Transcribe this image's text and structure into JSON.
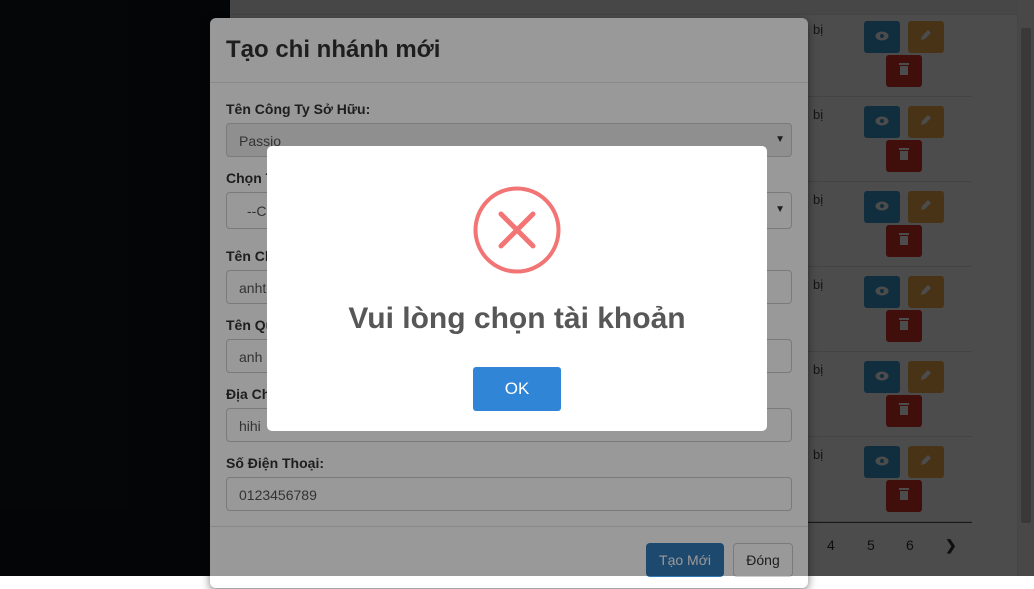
{
  "background_page": {
    "row_snippets": [
      "bị",
      "bị",
      "bị",
      "bị",
      "bị",
      "bị"
    ],
    "pagination": {
      "pages": [
        "4",
        "5",
        "6"
      ],
      "next_glyph": "❯"
    }
  },
  "create_branch_modal": {
    "title": "Tạo chi nhánh mới",
    "fields": [
      {
        "label": "Tên Công Ty Sở Hữu:",
        "value": "Passio",
        "type": "select"
      },
      {
        "label": "Chọn T",
        "value": "--Ch",
        "type": "select"
      },
      {
        "label": "Tên Ch",
        "value": "anhte",
        "type": "text"
      },
      {
        "label": "Tên Qu",
        "value": "anh",
        "type": "text"
      },
      {
        "label": "Địa Ch",
        "value": "hihi",
        "type": "text"
      },
      {
        "label": "Số Điện Thoại:",
        "value": "0123456789",
        "type": "text"
      }
    ],
    "submit_label": "Tạo Mới",
    "close_label": "Đóng"
  },
  "alert_dialog": {
    "icon": "error-x-icon",
    "message": "Vui lòng chọn tài khoản",
    "ok_label": "OK",
    "colors": {
      "icon": "#f27474",
      "ok_button": "#3085d6"
    }
  },
  "colors": {
    "view_button": "#3b9dd1",
    "edit_button": "#f0ad4e",
    "delete_button": "#d9342b",
    "primary_button": "#337ab7"
  }
}
